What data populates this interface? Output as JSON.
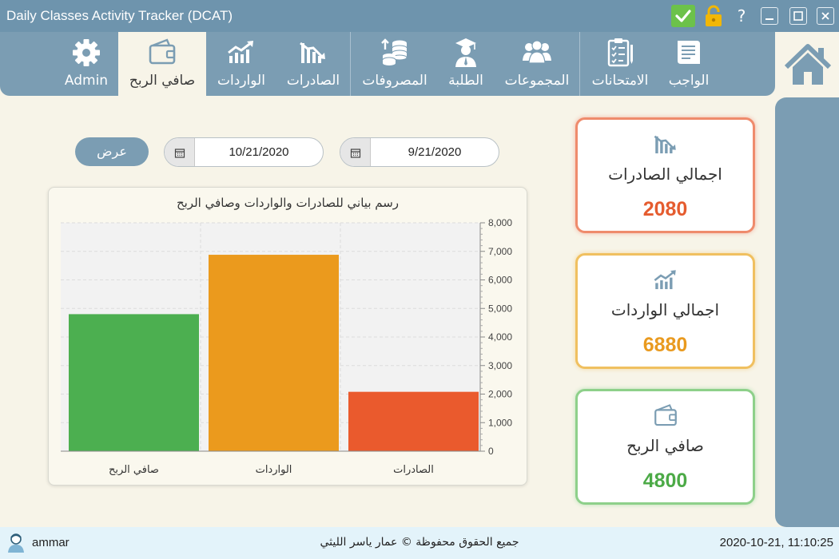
{
  "window": {
    "title": "Daily Classes Activity Tracker (DCAT)",
    "help_label": "?"
  },
  "nav": {
    "items": [
      {
        "label": "Admin",
        "icon": "gear-icon"
      },
      {
        "label": "صافي الربح",
        "icon": "wallet-icon",
        "active": true
      },
      {
        "label": "الواردات",
        "icon": "trend-up-icon"
      },
      {
        "label": "الصادرات",
        "icon": "trend-down-icon"
      },
      {
        "label": "المصروفات",
        "icon": "coins-icon"
      },
      {
        "label": "الطلبة",
        "icon": "graduate-icon"
      },
      {
        "label": "المجموعات",
        "icon": "group-icon"
      },
      {
        "label": "الامتحانات",
        "icon": "checklist-icon"
      },
      {
        "label": "الواجب",
        "icon": "notes-icon"
      }
    ]
  },
  "filters": {
    "show_label": "عرض",
    "date_to": "10/21/2020",
    "date_from": "9/21/2020"
  },
  "chart_data": {
    "type": "bar",
    "title": "رسم بياني للصادرات والواردات وصافي الربح",
    "categories": [
      "صافي الربح",
      "الواردات",
      "الصادرات"
    ],
    "values": [
      4800,
      6880,
      2080
    ],
    "colors": [
      "#4caf50",
      "#eb9a1d",
      "#ea5a2d"
    ],
    "ylim": [
      0,
      8000
    ],
    "y_ticks": [
      "0",
      "1,000",
      "2,000",
      "3,000",
      "4,000",
      "5,000",
      "6,000",
      "7,000",
      "8,000"
    ],
    "grid": true,
    "y_axis_side": "right"
  },
  "cards": {
    "expenses": {
      "label": "اجمالي الصادرات",
      "value": "2080",
      "color": "#e55c2f"
    },
    "income": {
      "label": "اجمالي الواردات",
      "value": "6880",
      "color": "#e99a1f"
    },
    "net": {
      "label": "صافي الربح",
      "value": "4800",
      "color": "#4caa47"
    }
  },
  "footer": {
    "username": "ammar",
    "copyright": "جميع الحقوق محفوظة © عمار ياسر الليثي",
    "datetime": "2020-10-21, 11:10:25"
  }
}
